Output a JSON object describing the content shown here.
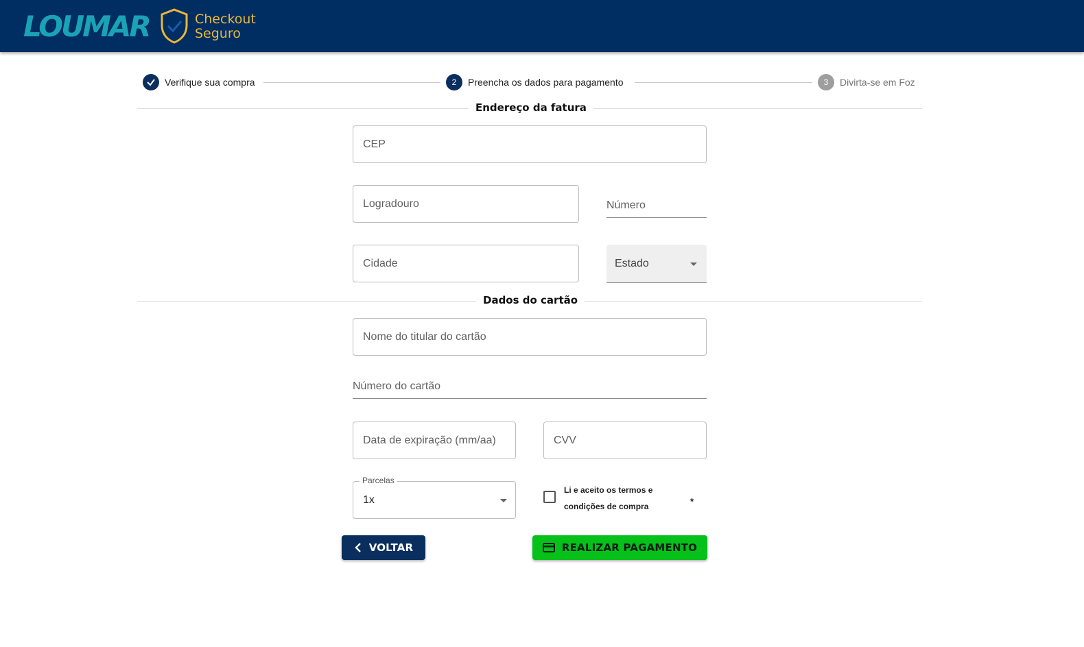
{
  "header": {
    "brand": "LOUMAR",
    "badge_line1": "Checkout",
    "badge_line2": "Seguro",
    "colors": {
      "header_bg": "#002d62",
      "brand": "#1aa3b6",
      "badge": "#e9b73a"
    }
  },
  "stepper": {
    "steps": [
      {
        "number": "",
        "label": "Verifique sua compra",
        "state": "done"
      },
      {
        "number": "2",
        "label": "Preencha os dados para pagamento",
        "state": "active"
      },
      {
        "number": "3",
        "label": "Divirta-se em Foz",
        "state": "todo"
      }
    ]
  },
  "billing": {
    "title": "Endereço da fatura",
    "cep_placeholder": "CEP",
    "logradouro_placeholder": "Logradouro",
    "numero_placeholder": "Número",
    "cidade_placeholder": "Cidade",
    "estado_placeholder": "Estado"
  },
  "card": {
    "title": "Dados do cartão",
    "holder_placeholder": "Nome do titular do cartão",
    "number_placeholder": "Número do cartão",
    "expiry_placeholder": "Data de expiração (mm/aa)",
    "cvv_placeholder": "CVV",
    "installments_label": "Parcelas",
    "installments_value": "1x",
    "terms_text": "Li e aceito os termos e condições de compra",
    "terms_required": "*"
  },
  "actions": {
    "back_label": "VOLTAR",
    "pay_label": "REALIZAR PAGAMENTO",
    "colors": {
      "back": "#0a2e5e",
      "pay": "#06c119"
    }
  }
}
